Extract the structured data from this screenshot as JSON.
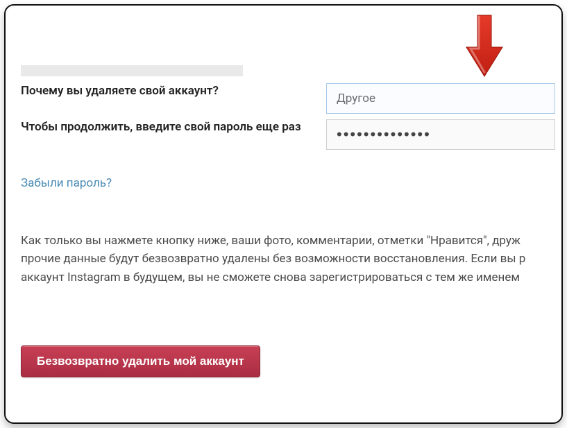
{
  "reason": {
    "label": "Почему вы удаляете свой аккаунт?",
    "selected": "Другое"
  },
  "password": {
    "label": "Чтобы продолжить, введите свой пароль еще раз",
    "masked_value": "••••••••••••••"
  },
  "forgot_password": "Забыли пароль?",
  "warning": "Как только вы нажмете кнопку ниже, ваши фото, комментарии, отметки \"Нравится\", друж прочие данные будут безвозвратно удалены без возможности восстановления. Если вы р аккаунт Instagram в будущем, вы не сможете снова зарегистрироваться с тем же именем",
  "delete_button": "Безвозвратно удалить мой аккаунт"
}
